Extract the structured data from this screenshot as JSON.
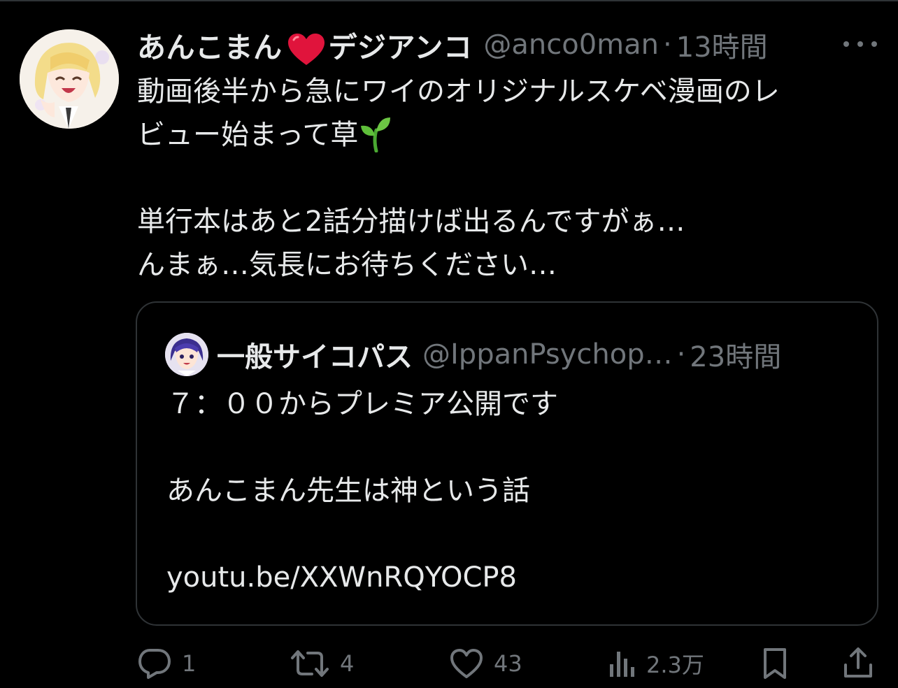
{
  "tweet": {
    "author_name_part1": "あんこまん",
    "author_name_emoji": "heart-emoji",
    "author_name_part2": "デジアンコ",
    "handle": "@anco0man",
    "separator": "·",
    "time": "13時間",
    "text_lines": [
      "動画後半から急にワイのオリジナルスケベ漫画のレ",
      "ビュー始まって草",
      "",
      "単行本はあと2話分描けば出るんですがぁ…",
      "んまぁ…気長にお待ちください…"
    ],
    "inline_emoji": "seedling-emoji"
  },
  "quote": {
    "author_name": "一般サイコパス",
    "handle": "@IppanPsychop…",
    "separator": "·",
    "time": "23時間",
    "text_lines": [
      "７：００からプレミア公開です",
      "",
      "あんこまん先生は神という話",
      "",
      "youtu.be/XXWnRQYOCP8"
    ]
  },
  "actions": {
    "replies": "1",
    "reposts": "4",
    "likes": "43",
    "views": "2.3万"
  },
  "icons": {
    "reply": "reply-icon",
    "repost": "repost-icon",
    "like": "like-icon",
    "views": "views-icon",
    "bookmark": "bookmark-icon",
    "share": "share-icon",
    "more": "more-icon"
  },
  "colors": {
    "background": "#000000",
    "text": "#e7e9ea",
    "secondary": "#71767b",
    "border": "#2f3336",
    "heart": "#e0143c",
    "sprout": "#5fbf3a"
  }
}
